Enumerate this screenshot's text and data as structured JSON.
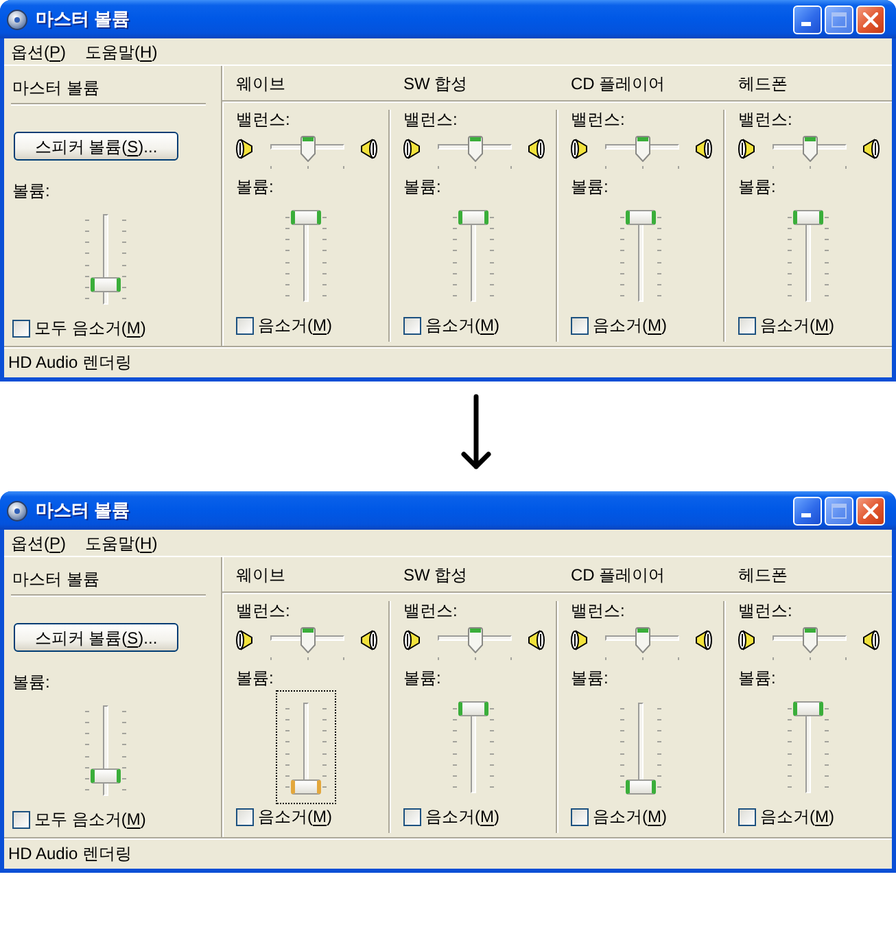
{
  "windows": [
    {
      "title": "마스터 볼륨",
      "title_buttons": [
        {
          "kind": "minimize",
          "disabled": false
        },
        {
          "kind": "maximize",
          "disabled": true
        },
        {
          "kind": "close",
          "disabled": false
        }
      ],
      "menu": [
        "옵션(P)",
        "도움말(H)"
      ],
      "master": {
        "name": "마스터 볼륨",
        "button": "스피커 볼륨(S)...",
        "volume_label": "볼륨:",
        "volume": {
          "level": 0.16,
          "focused": false
        },
        "mute": {
          "label": "모두 음소거(M)",
          "checked": false
        }
      },
      "channels": [
        {
          "name": "웨이브",
          "balance_label": "밸런스:",
          "balance": {
            "level": 0.5
          },
          "volume_label": "볼륨:",
          "volume": {
            "level": 1,
            "focused": false
          },
          "mute": {
            "label": "음소거(M)",
            "checked": false
          }
        },
        {
          "name": "SW 합성",
          "balance_label": "밸런스:",
          "balance": {
            "level": 0.5
          },
          "volume_label": "볼륨:",
          "volume": {
            "level": 1,
            "focused": false
          },
          "mute": {
            "label": "음소거(M)",
            "checked": false
          }
        },
        {
          "name": "CD 플레이어",
          "balance_label": "밸런스:",
          "balance": {
            "level": 0.5
          },
          "volume_label": "볼륨:",
          "volume": {
            "level": 1,
            "focused": false
          },
          "mute": {
            "label": "음소거(M)",
            "checked": false
          }
        },
        {
          "name": "헤드폰",
          "balance_label": "밸런스:",
          "balance": {
            "level": 0.5
          },
          "volume_label": "볼륨:",
          "volume": {
            "level": 1,
            "focused": false
          },
          "mute": {
            "label": "음소거(M)",
            "checked": false
          }
        }
      ],
      "status_bar": "HD Audio 렌더링"
    },
    {
      "title": "마스터 볼륨",
      "title_buttons": [
        {
          "kind": "minimize",
          "disabled": false
        },
        {
          "kind": "maximize",
          "disabled": true
        },
        {
          "kind": "close",
          "disabled": false
        }
      ],
      "menu": [
        "옵션(P)",
        "도움말(H)"
      ],
      "master": {
        "name": "마스터 볼륨",
        "button": "스피커 볼륨(S)...",
        "volume_label": "볼륨:",
        "volume": {
          "level": 0.16,
          "focused": false
        },
        "mute": {
          "label": "모두 음소거(M)",
          "checked": false
        }
      },
      "channels": [
        {
          "name": "웨이브",
          "balance_label": "밸런스:",
          "balance": {
            "level": 0.5
          },
          "volume_label": "볼륨:",
          "volume": {
            "level": 0,
            "focused": true
          },
          "mute": {
            "label": "음소거(M)",
            "checked": false
          }
        },
        {
          "name": "SW 합성",
          "balance_label": "밸런스:",
          "balance": {
            "level": 0.5
          },
          "volume_label": "볼륨:",
          "volume": {
            "level": 1,
            "focused": false
          },
          "mute": {
            "label": "음소거(M)",
            "checked": false
          }
        },
        {
          "name": "CD 플레이어",
          "balance_label": "밸런스:",
          "balance": {
            "level": 0.5
          },
          "volume_label": "볼륨:",
          "volume": {
            "level": 0,
            "focused": false
          },
          "mute": {
            "label": "음소거(M)",
            "checked": false
          }
        },
        {
          "name": "헤드폰",
          "balance_label": "밸런스:",
          "balance": {
            "level": 0.5
          },
          "volume_label": "볼륨:",
          "volume": {
            "level": 1,
            "focused": false
          },
          "mute": {
            "label": "음소거(M)",
            "checked": false
          }
        }
      ],
      "status_bar": "HD Audio 렌더링"
    }
  ]
}
